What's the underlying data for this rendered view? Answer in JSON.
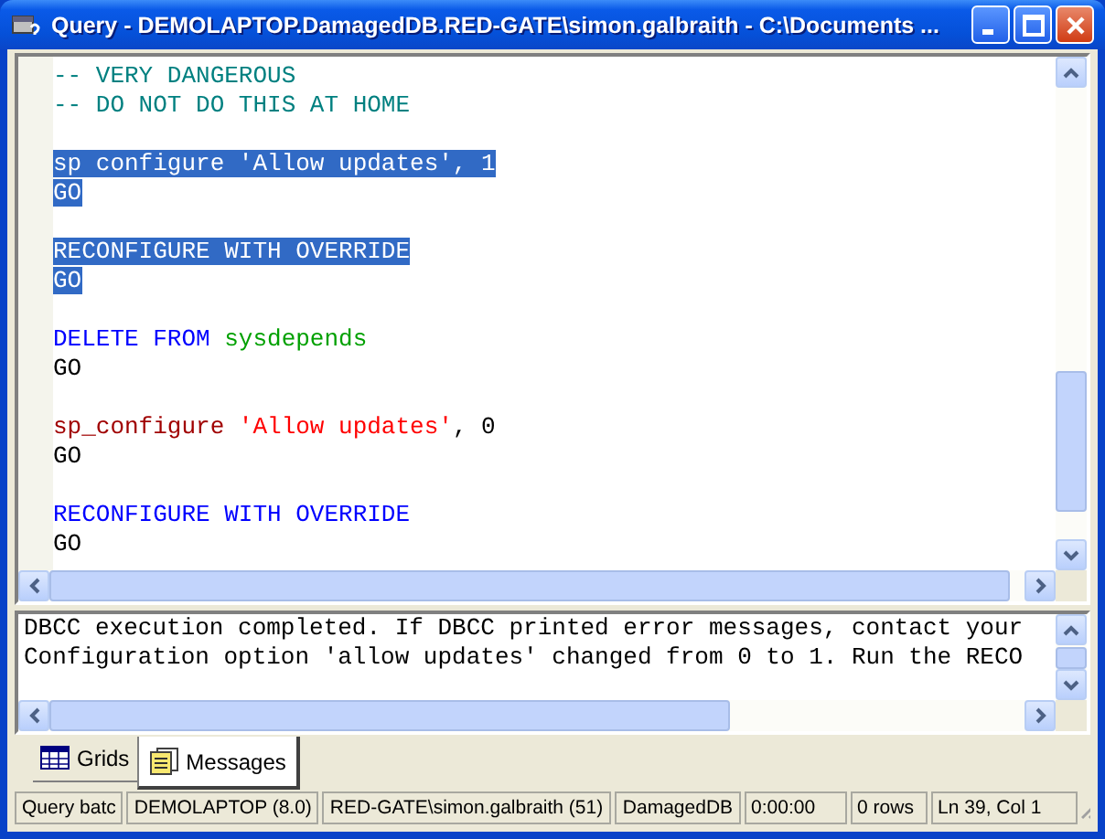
{
  "window": {
    "title": "Query - DEMOLAPTOP.DamagedDB.RED-GATE\\simon.galbraith - C:\\Documents ..."
  },
  "editor": {
    "lines": [
      {
        "selected": false,
        "tokens": [
          {
            "kind": "comment",
            "text": "-- VERY DANGEROUS"
          }
        ]
      },
      {
        "selected": false,
        "tokens": [
          {
            "kind": "comment",
            "text": "-- DO NOT DO THIS AT HOME"
          }
        ]
      },
      {
        "kind": "blank"
      },
      {
        "selected": true,
        "tokens": [
          {
            "kind": "plain",
            "text": "sp configure 'Allow updates', 1"
          }
        ]
      },
      {
        "selected": true,
        "tokens": [
          {
            "kind": "plain",
            "text": "GO"
          }
        ]
      },
      {
        "kind": "blank"
      },
      {
        "selected": true,
        "tokens": [
          {
            "kind": "plain",
            "text": "RECONFIGURE WITH OVERRIDE"
          }
        ]
      },
      {
        "selected": true,
        "tokens": [
          {
            "kind": "plain",
            "text": "GO"
          }
        ]
      },
      {
        "kind": "blank"
      },
      {
        "selected": false,
        "tokens": [
          {
            "kind": "keyword",
            "text": "DELETE FROM"
          },
          {
            "kind": "object",
            "text": "sysdepends",
            "space_before": true
          }
        ]
      },
      {
        "selected": false,
        "tokens": [
          {
            "kind": "plain",
            "text": "GO"
          }
        ]
      },
      {
        "kind": "blank"
      },
      {
        "selected": false,
        "tokens": [
          {
            "kind": "proc",
            "text": "sp_configure"
          },
          {
            "kind": "string",
            "text": "'Allow updates'",
            "space_before": true
          },
          {
            "kind": "plain",
            "text": ", 0"
          }
        ]
      },
      {
        "selected": false,
        "tokens": [
          {
            "kind": "plain",
            "text": "GO"
          }
        ]
      },
      {
        "kind": "blank"
      },
      {
        "selected": false,
        "tokens": [
          {
            "kind": "keyword",
            "text": "RECONFIGURE WITH OVERRIDE"
          }
        ]
      },
      {
        "selected": false,
        "tokens": [
          {
            "kind": "plain",
            "text": "GO"
          }
        ]
      }
    ]
  },
  "messages": [
    "DBCC execution completed. If DBCC printed error messages, contact your",
    "Configuration option 'allow updates' changed from 0 to 1. Run the RECO"
  ],
  "tabs": [
    {
      "label": "Grids",
      "selected": false
    },
    {
      "label": "Messages",
      "selected": true
    }
  ],
  "status_bar": [
    "Query batc",
    "DEMOLAPTOP (8.0)",
    "RED-GATE\\simon.galbraith (51)",
    "DamagedDB",
    "0:00:00",
    "0 rows",
    "Ln 39, Col 1"
  ]
}
